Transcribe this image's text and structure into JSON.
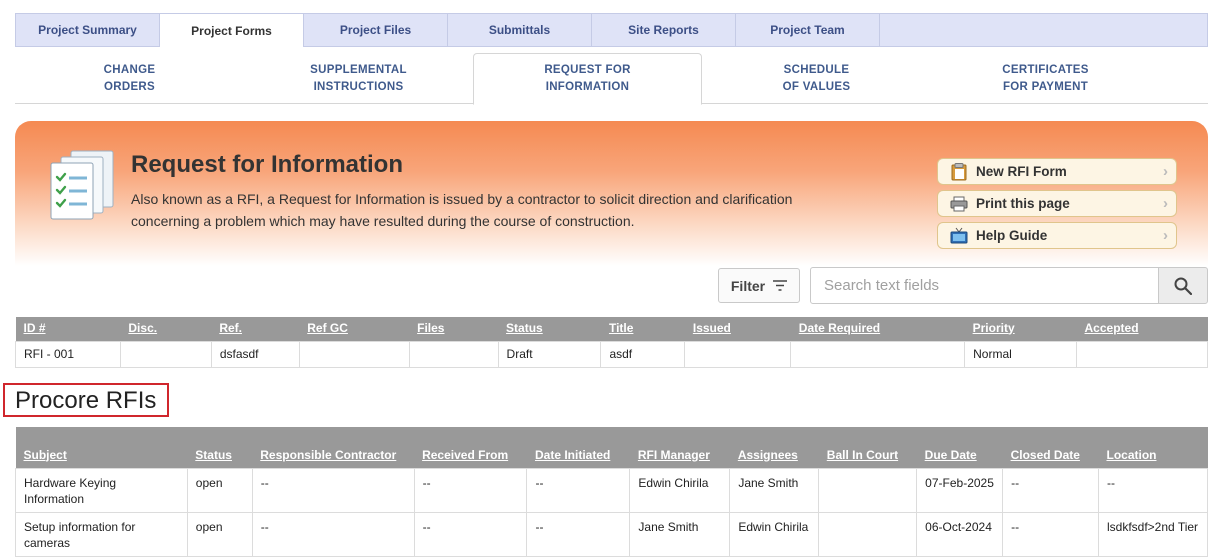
{
  "tabs": [
    "Project Summary",
    "Project Forms",
    "Project Files",
    "Submittals",
    "Site Reports",
    "Project Team"
  ],
  "subtabs": [
    "CHANGE\nORDERS",
    "SUPPLEMENTAL\nINSTRUCTIONS",
    "REQUEST FOR\nINFORMATION",
    "SCHEDULE\nOF VALUES",
    "CERTIFICATES\nFOR PAYMENT"
  ],
  "banner": {
    "title": "Request for Information",
    "description": "Also known as a RFI, a Request for Information is issued by a contractor to solicit direction and clarification concerning a problem which may have resulted during the course of construction.",
    "actions": [
      {
        "label": "New RFI Form",
        "icon": "clipboard-icon"
      },
      {
        "label": "Print this page",
        "icon": "printer-icon"
      },
      {
        "label": "Help Guide",
        "icon": "tv-icon"
      }
    ]
  },
  "filter": {
    "label": "Filter"
  },
  "search": {
    "placeholder": "Search text fields"
  },
  "rfi_table": {
    "headers": [
      "ID #",
      "Disc.",
      "Ref.",
      "Ref GC",
      "Files",
      "Status",
      "Title",
      "Issued",
      "Date Required",
      "Priority",
      "Accepted"
    ],
    "rows": [
      [
        "RFI - 001",
        "",
        "dsfasdf",
        "",
        "",
        "Draft",
        "asdf",
        "",
        "",
        "Normal",
        ""
      ]
    ]
  },
  "procore": {
    "title": "Procore RFIs",
    "headers": [
      "Subject",
      "Status",
      "Responsible Contractor",
      "Received From",
      "Date Initiated",
      "RFI Manager",
      "Assignees",
      "Ball In Court",
      "Due Date",
      "Closed Date",
      "Location"
    ],
    "rows": [
      [
        "Hardware Keying Information",
        "open",
        "--",
        "--",
        "--",
        "Edwin Chirila",
        "Jane Smith",
        "",
        "07-Feb-2025",
        "--",
        "--"
      ],
      [
        "Setup information for cameras",
        "open",
        "--",
        "--",
        "--",
        "Jane Smith",
        "Edwin Chirila",
        "",
        "06-Oct-2024",
        "--",
        "lsdkfsdf>2nd Tier"
      ]
    ]
  },
  "colors": {
    "tab_bg": "#dfe3f7",
    "tab_text": "#3c4f86",
    "banner_orange": "#f58a52",
    "header_gray": "#999999",
    "highlight_red": "#d0262c"
  }
}
